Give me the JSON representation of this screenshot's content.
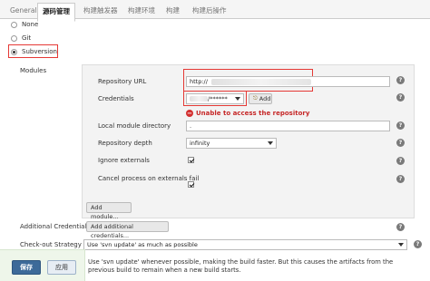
{
  "tabs": [
    {
      "label": "General"
    },
    {
      "label": "源码管理"
    },
    {
      "label": "构建触发器"
    },
    {
      "label": "构建环境"
    },
    {
      "label": "构建"
    },
    {
      "label": "构建后操作"
    }
  ],
  "scm": {
    "options": [
      {
        "label": "None",
        "selected": false
      },
      {
        "label": "Git",
        "selected": false
      },
      {
        "label": "Subversion",
        "selected": true
      }
    ]
  },
  "modules": {
    "section_label": "Modules",
    "repository_url": {
      "label": "Repository URL",
      "value": "http://"
    },
    "credentials": {
      "label": "Credentials",
      "value": "/******",
      "add_label": "Add",
      "error": "Unable to access the repository"
    },
    "local_module_directory": {
      "label": "Local module directory",
      "value": "."
    },
    "repository_depth": {
      "label": "Repository depth",
      "value": "infinity"
    },
    "ignore_externals": {
      "label": "Ignore externals",
      "checked": true
    },
    "cancel_process": {
      "label": "Cancel process on externals fail",
      "checked": true
    },
    "add_module_label": "Add module..."
  },
  "additional_credentials": {
    "label": "Additional Credentials",
    "button_label": "Add additional credentials..."
  },
  "checkout_strategy": {
    "label": "Check-out Strategy",
    "value": "Use 'svn update' as much as possible",
    "description": "Use 'svn update' whenever possible, making the build faster. But this causes the artifacts from the previous build to remain when a new build starts."
  },
  "footer": {
    "save_label": "保存",
    "apply_label": "应用"
  },
  "help_glyph": "?",
  "error_glyph": "−",
  "icons": {
    "add": "key-icon",
    "help": "help-icon",
    "error": "error-icon"
  },
  "colors": {
    "error": "#d32f2f",
    "highlight_box": "#e53935",
    "save_button": "#3d6a99",
    "panel": "#f3f3f3"
  }
}
